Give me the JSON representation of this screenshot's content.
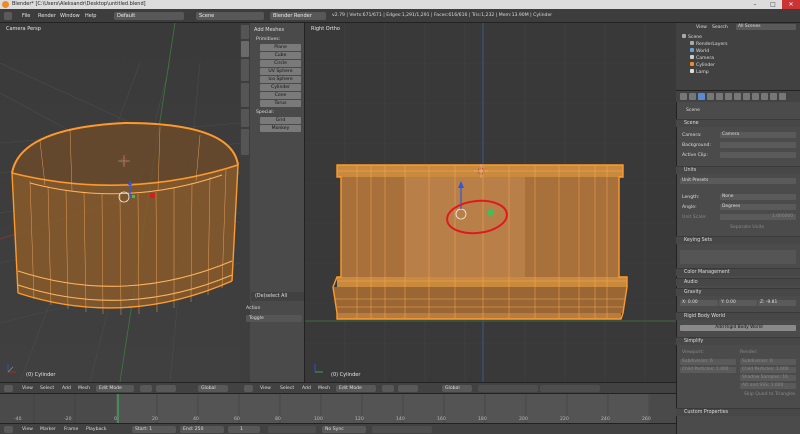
{
  "window": {
    "title": "Blender* [C:\\Users\\Aleksandr\\Desktop\\untitled.blend]",
    "buttons": [
      "–",
      "□",
      "✕"
    ]
  },
  "infobar": {
    "menus": [
      "File",
      "Render",
      "Window",
      "Help"
    ],
    "layout": "Default",
    "scene": "Scene",
    "engine": "Blender Render",
    "stats": "v2.79 | Verts:671/671 | Edges:1,291/1,291 | Faces:616/616 | Tris:1,232 | Mem:13.90M | Cylinder"
  },
  "left_viewport": {
    "label": "Camera Persp",
    "object": "(0) Cylinder"
  },
  "right_viewport": {
    "label": "Right Ortho",
    "object": "(0) Cylinder"
  },
  "toolshelf": {
    "tabs": [
      "Tools",
      "Create",
      "Relations",
      "Animation",
      "Physics",
      "Grease Pencil"
    ],
    "section_add": "Add Meshes",
    "primitives_label": "Primitives:",
    "primitives": [
      "Plane",
      "Cube",
      "Circle",
      "UV Sphere",
      "Ico Sphere",
      "Cylinder",
      "Cone",
      "Torus"
    ],
    "special_label": "Special:",
    "special": [
      "Grid",
      "Monkey"
    ],
    "last_op": "(De)select All",
    "action_label": "Action",
    "action_value": "Toggle"
  },
  "outliner": {
    "menus": [
      "View",
      "Search",
      "All Scenes"
    ],
    "tree": [
      "Scene",
      "RenderLayers",
      "World",
      "Camera",
      "Cylinder",
      "Lamp"
    ]
  },
  "properties": {
    "scene_name": "Scene",
    "scene_section": "Scene",
    "camera_label": "Camera:",
    "camera_value": "Camera",
    "background_label": "Background:",
    "active_clip_label": "Active Clip:",
    "units_section": "Units",
    "unit_presets": "Unit Presets",
    "length_label": "Length:",
    "length_value": "None",
    "angle_label": "Angle:",
    "angle_value": "Degrees",
    "unit_scale_label": "Unit Scale:",
    "unit_scale_value": "1.000000",
    "separate_units": "Separate Units",
    "keying_sets": "Keying Sets",
    "color_management": "Color Management",
    "audio": "Audio",
    "gravity": "Gravity",
    "gravity_x": "X:",
    "gravity_x_value": "0.00",
    "gravity_y": "Y:",
    "gravity_y_value": "0.00",
    "gravity_z": "Z:",
    "gravity_z_value": "-9.81",
    "rigid_body_world": "Rigid Body World",
    "add_rigid_body_world": "Add Rigid Body World",
    "simplify": "Simplify",
    "simplify_viewport": "Viewport:",
    "simplify_render": "Render:",
    "subdivision": "Subdivision:",
    "subdivision_value": "6",
    "child_particles": "Child Particles:",
    "child_particles_value": "1.000",
    "render_subdivision": "Subdivision:",
    "render_subdivision_value": "6",
    "render_child_particles": "Child Particles:",
    "render_child_particles_value": "1.000",
    "shadow_samples": "Shadow Samples:",
    "shadow_samples_value": "16",
    "ao_and_sss": "AO and SSS:",
    "ao_and_sss_value": "1.000",
    "skip_quad_to_triangles": "Skip Quad to Triangles",
    "custom_properties": "Custom Properties"
  },
  "viewport_header": {
    "menus": [
      "View",
      "Select",
      "Add",
      "Mesh"
    ],
    "mode": "Edit Mode",
    "orientation": "Global"
  },
  "timeline": {
    "ticks": [
      "-40",
      "-20",
      "0",
      "20",
      "40",
      "60",
      "80",
      "100",
      "120",
      "140",
      "160",
      "180",
      "200",
      "220",
      "240",
      "260"
    ],
    "menus": [
      "View",
      "Marker",
      "Frame",
      "Playback"
    ],
    "start_label": "Start:",
    "start_value": "1",
    "end_label": "End:",
    "end_value": "250",
    "current": "1",
    "sync": "No Sync"
  },
  "colors": {
    "accent_orange": "#f08a24",
    "wire_orange": "#ff9a2a",
    "annotation_red": "#e0191e",
    "axis_green": "#3cc15a",
    "axis_blue": "#2e56e6"
  }
}
